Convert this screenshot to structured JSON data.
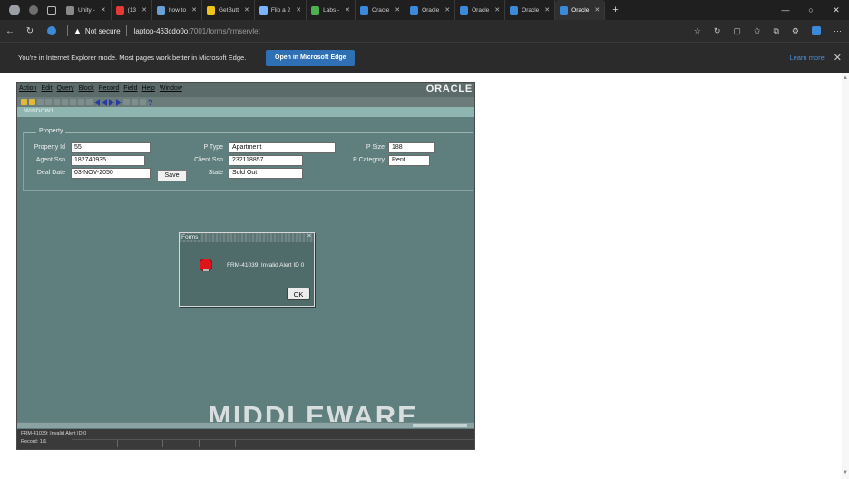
{
  "browser": {
    "tabs": [
      {
        "label": "Unity -",
        "color": "#8a8a8a"
      },
      {
        "label": "(13",
        "color": "#e53935"
      },
      {
        "label": "how to",
        "color": "#6aa0d8"
      },
      {
        "label": "GetButt",
        "color": "#f0c419"
      },
      {
        "label": "Flip a 2",
        "color": "#7ab3ff"
      },
      {
        "label": "Labs -",
        "color": "#4caf50"
      },
      {
        "label": "Oracle",
        "color": "#3b8ad9"
      },
      {
        "label": "Oracle",
        "color": "#3b8ad9"
      },
      {
        "label": "Oracle",
        "color": "#3b8ad9"
      },
      {
        "label": "Oracle",
        "color": "#3b8ad9"
      },
      {
        "label": "Oracle",
        "color": "#3b8ad9"
      }
    ],
    "new_tab_glyph": "+",
    "window_controls": [
      "—",
      "○",
      "✕"
    ],
    "not_secure": "Not secure",
    "url_host": "laptop-463cdo0o",
    "url_path": ":7001/forms/frmservlet",
    "ie_message": "You're in Internet Explorer mode. Most pages work better in Microsoft Edge.",
    "open_edge_button": "Open in Microsoft Edge",
    "learn_more": "Learn more"
  },
  "forms": {
    "menu": [
      "Action",
      "Edit",
      "Query",
      "Block",
      "Record",
      "Field",
      "Help",
      "Window"
    ],
    "logo": "ORACLE",
    "window_title": "WINDOW1",
    "frame_title": "Property",
    "fields": {
      "property_id": {
        "label": "Property Id",
        "value": "55"
      },
      "agent_ssn": {
        "label": "Agent Ssn",
        "value": "182740935"
      },
      "deal_date": {
        "label": "Deal Date",
        "value": "03-NOV-2050"
      },
      "p_type": {
        "label": "P Type",
        "value": "Apartment"
      },
      "client_ssn": {
        "label": "Client Ssn",
        "value": "232118857"
      },
      "state": {
        "label": "State",
        "value": "Sold Out"
      },
      "p_size": {
        "label": "P Size",
        "value": "188"
      },
      "p_category": {
        "label": "P Category",
        "value": "Rent"
      }
    },
    "save_button": "Save",
    "dialog": {
      "title": "Forms",
      "message": "FRM-41039: Invalid Alert ID 0",
      "ok_prefix": "",
      "ok_underlined": "O",
      "ok_rest": "K"
    },
    "watermark": "MIDDLEWARE",
    "status_line": "FRM-41039: Invalid Alert ID 0",
    "record_line": "Record: 1/1"
  },
  "colors": {
    "applet_bg": "#5f7f7e",
    "edge_blue": "#2f6fb4"
  }
}
